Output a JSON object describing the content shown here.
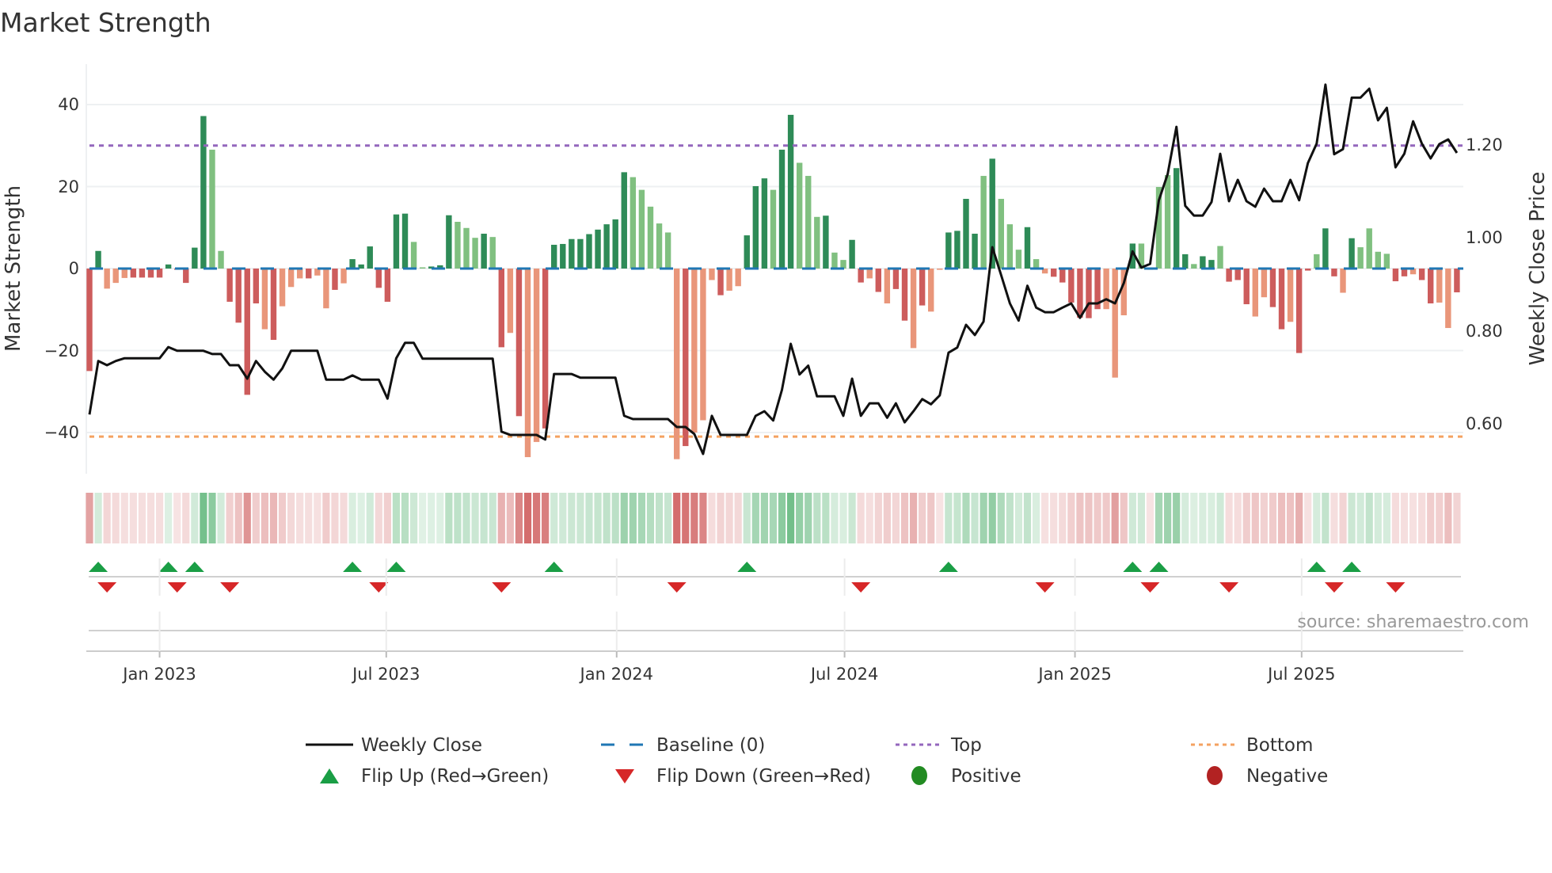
{
  "chart_data": {
    "type": "bar",
    "title": "Market Strength",
    "ylabel": "Market Strength",
    "y2label": "Weekly Close Price",
    "ylim": [
      -50,
      50
    ],
    "y2lim": [
      0.48,
      1.36
    ],
    "start_week": "2022-11-06",
    "interval": "weekly",
    "yticks": [
      "40",
      "20",
      "0",
      "−20",
      "−40"
    ],
    "ytick_values": [
      40,
      20,
      0,
      -20,
      -40
    ],
    "y2ticks": [
      "1.20",
      "1.00",
      "0.80",
      "0.60"
    ],
    "y2tick_values": [
      1.2,
      1.0,
      0.8,
      0.6
    ],
    "xticks": [
      {
        "label": "Jan 2023",
        "date": "2023-01-01"
      },
      {
        "label": "Jul 2023",
        "date": "2023-07-01"
      },
      {
        "label": "Jan 2024",
        "date": "2024-01-01"
      },
      {
        "label": "Jul 2024",
        "date": "2024-07-01"
      },
      {
        "label": "Jan 2025",
        "date": "2025-01-01"
      },
      {
        "label": "Jul 2025",
        "date": "2025-07-01"
      }
    ],
    "top_level": 30,
    "bottom_level": -41,
    "strength": [
      -25,
      4.3,
      -4.9,
      -3.5,
      -2.3,
      -2.2,
      -2.2,
      -2.2,
      -2.2,
      1,
      -0.3,
      -3.5,
      5.1,
      37.2,
      29,
      4.3,
      -8.1,
      -13.2,
      -30.8,
      -8.5,
      -14.8,
      -17.4,
      -9.2,
      -4.5,
      -2.4,
      -2.4,
      -1.7,
      -9.7,
      -5.2,
      -3.6,
      2.3,
      1,
      5.4,
      -4.7,
      -8.1,
      13.2,
      13.4,
      6.5,
      0.3,
      0.5,
      0.8,
      13,
      11.4,
      9.9,
      7.5,
      8.5,
      7.7,
      -19.2,
      -15.7,
      -36,
      -46,
      -42.3,
      -39,
      5.8,
      6,
      7.2,
      7.2,
      8.4,
      9.5,
      10.8,
      12,
      23.5,
      22.3,
      19.2,
      15.1,
      11,
      8.8,
      -46.5,
      -43.3,
      -40,
      -37,
      -2.8,
      -6.5,
      -5.4,
      -4.3,
      8.1,
      20.1,
      22,
      19.2,
      29,
      37.5,
      25.8,
      22.6,
      12.6,
      12.9,
      3.9,
      2.1,
      7,
      -3.4,
      -2.4,
      -5.7,
      -8.5,
      -5,
      -12.7,
      -19.4,
      -9,
      -10.5,
      -0.3,
      8.8,
      9.2,
      17,
      8.5,
      22.6,
      26.8,
      17,
      10.8,
      4.6,
      10.1,
      2.3,
      -1.2,
      -2,
      -3.4,
      -8.3,
      -12,
      -12.1,
      -9.9,
      -9.9,
      -26.6,
      -11.4,
      6.1,
      6.1,
      -0.3,
      19.9,
      22.8,
      24.5,
      3.5,
      1.1,
      3,
      2.1,
      5.5,
      -3.2,
      -2.8,
      -8.7,
      -11.7,
      -7,
      -9.4,
      -14.8,
      -13,
      -20.6,
      -0.5,
      3.5,
      9.8,
      -1.9,
      -5.9,
      7.4,
      5.2,
      9.8,
      4.1,
      3.6,
      -3.1,
      -1.9,
      -1.4,
      -2.8,
      -8.5,
      -8.3,
      -14.5,
      -5.8
    ],
    "strength_shade": "ddllldddddddddllddddldllldlldldddddddlldddllldldldllddddddddddlllllldllldlldddlddllldllddldlddldllddddldllldllddddddllldldllddlddldddllddlddlddldllllddlddllddldl",
    "weekly_close": [
      0.62,
      0.735,
      0.726,
      0.735,
      0.741,
      0.741,
      0.741,
      0.741,
      0.741,
      0.765,
      0.757,
      0.757,
      0.757,
      0.757,
      0.75,
      0.75,
      0.726,
      0.726,
      0.697,
      0.735,
      0.712,
      0.695,
      0.719,
      0.757,
      0.757,
      0.757,
      0.757,
      0.695,
      0.695,
      0.695,
      0.704,
      0.695,
      0.695,
      0.695,
      0.654,
      0.741,
      0.774,
      0.774,
      0.74,
      0.74,
      0.74,
      0.74,
      0.74,
      0.74,
      0.74,
      0.74,
      0.74,
      0.583,
      0.576,
      0.576,
      0.576,
      0.576,
      0.566,
      0.707,
      0.707,
      0.707,
      0.699,
      0.699,
      0.699,
      0.699,
      0.699,
      0.617,
      0.61,
      0.61,
      0.61,
      0.61,
      0.61,
      0.593,
      0.593,
      0.578,
      0.535,
      0.617,
      0.576,
      0.576,
      0.576,
      0.576,
      0.617,
      0.627,
      0.607,
      0.673,
      0.772,
      0.706,
      0.725,
      0.659,
      0.659,
      0.659,
      0.617,
      0.697,
      0.617,
      0.644,
      0.644,
      0.613,
      0.644,
      0.603,
      0.627,
      0.653,
      0.642,
      0.661,
      0.753,
      0.764,
      0.813,
      0.791,
      0.82,
      0.98,
      0.92,
      0.859,
      0.822,
      0.897,
      0.85,
      0.84,
      0.84,
      0.85,
      0.859,
      0.828,
      0.859,
      0.859,
      0.868,
      0.859,
      0.903,
      0.971,
      0.936,
      0.944,
      1.081,
      1.137,
      1.239,
      1.069,
      1.048,
      1.048,
      1.077,
      1.181,
      1.079,
      1.125,
      1.079,
      1.067,
      1.106,
      1.079,
      1.079,
      1.125,
      1.081,
      1.161,
      1.203,
      1.33,
      1.18,
      1.191,
      1.302,
      1.302,
      1.321,
      1.253,
      1.28,
      1.152,
      1.181,
      1.251,
      1.203,
      1.171,
      1.202,
      1.212,
      1.183
    ],
    "flip_up_weeks": [
      2,
      10,
      13,
      31,
      36,
      54,
      76,
      99,
      120,
      123,
      141,
      145
    ],
    "flip_down_weeks": [
      3,
      11,
      17,
      34,
      48,
      68,
      89,
      110,
      122,
      131,
      143,
      150
    ],
    "legend": {
      "placement": "bottom",
      "items": [
        {
          "label": "Weekly Close",
          "icon": "solid-line"
        },
        {
          "label": "Baseline (0)",
          "icon": "dashed-line"
        },
        {
          "label": "Top",
          "icon": "dotted-line"
        },
        {
          "label": "Bottom",
          "icon": "dotted-line"
        },
        {
          "label": "Flip Up (Red→Green)",
          "icon": "triangle-up"
        },
        {
          "label": "Flip Down (Green→Red)",
          "icon": "triangle-down"
        },
        {
          "label": "Positive",
          "icon": "circle"
        },
        {
          "label": "Negative",
          "icon": "circle"
        }
      ]
    },
    "source": "source: sharemaestro.com",
    "colors": {
      "pos_strong": "#2e8b57",
      "pos_weak": "#80c080",
      "neg_strong": "#cd5c5c",
      "neg_weak": "#e9967a",
      "baseline": "#1f77b4",
      "top": "#9467bd",
      "bottom": "#f4a261",
      "close": "#111111",
      "flip_up": "#1a9e45",
      "flip_down": "#d62728",
      "positive": "#228b22",
      "negative": "#b22222"
    }
  }
}
